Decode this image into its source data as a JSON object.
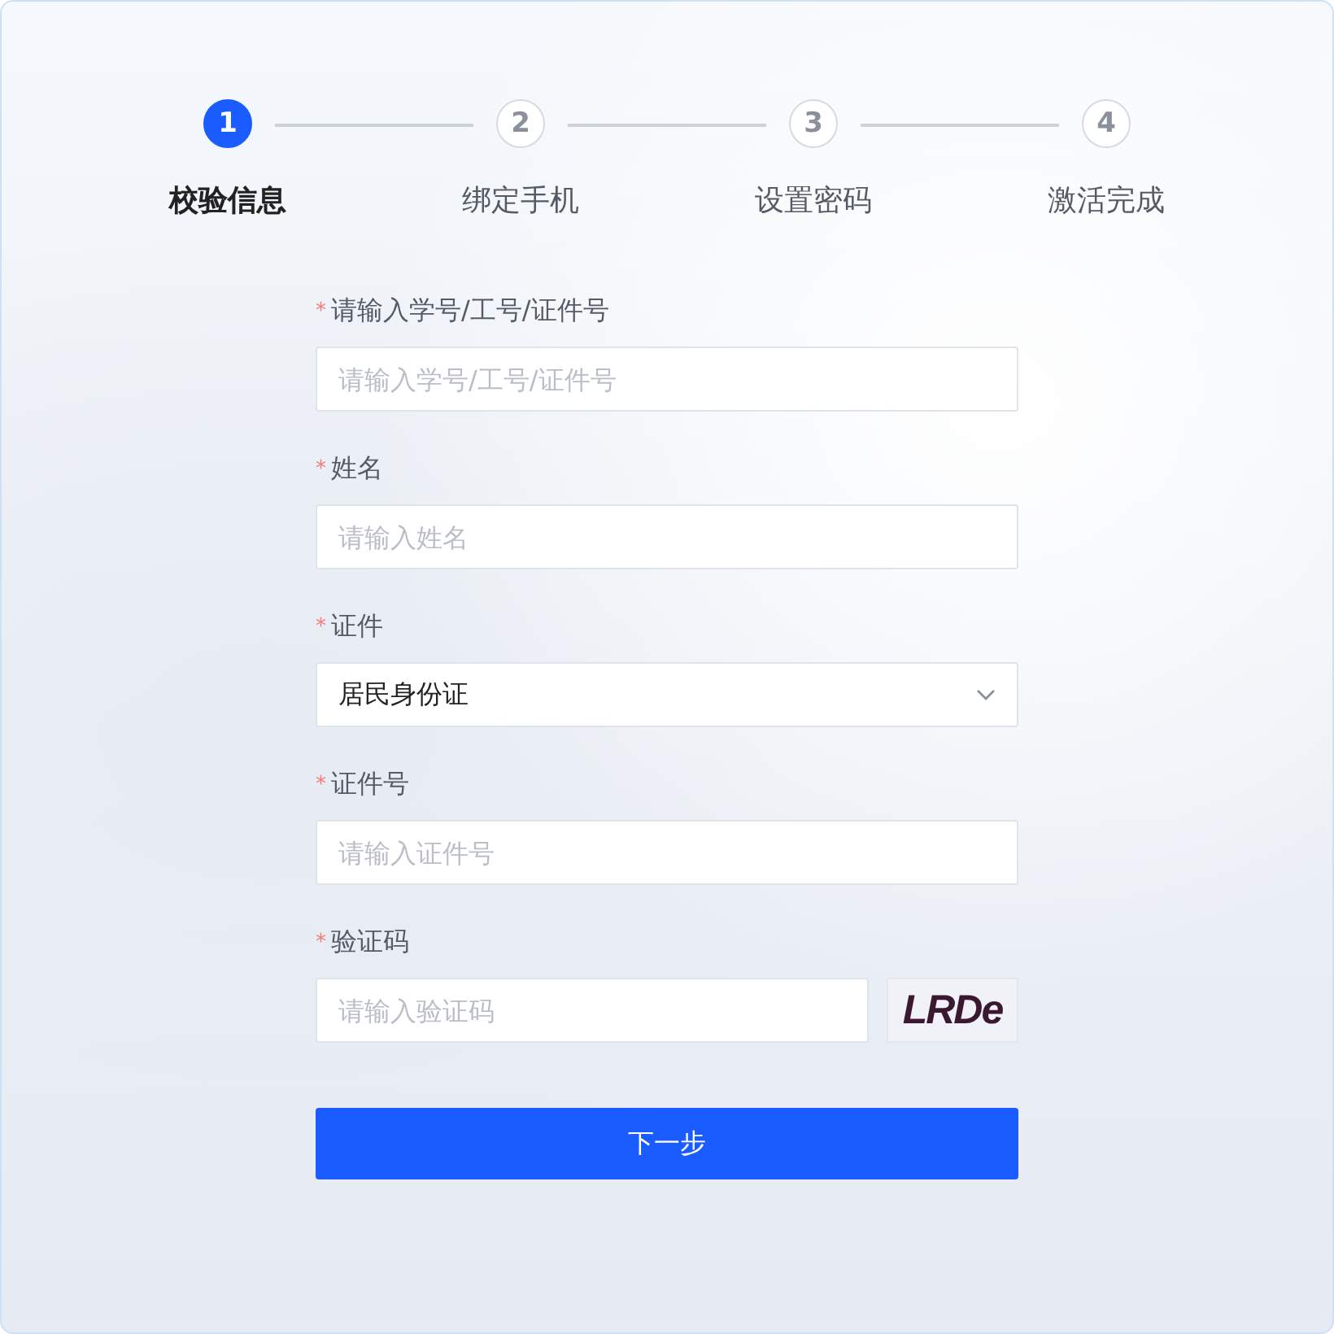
{
  "steps": [
    {
      "number": "1",
      "label": "校验信息",
      "selected": true
    },
    {
      "number": "2",
      "label": "绑定手机",
      "selected": false
    },
    {
      "number": "3",
      "label": "设置密码",
      "selected": false
    },
    {
      "number": "4",
      "label": "激活完成",
      "selected": false
    }
  ],
  "fields": [
    {
      "kind": "text",
      "required_mark": "*",
      "label": "请输入学号/工号/证件号",
      "placeholder": "请输入学号/工号/证件号"
    },
    {
      "kind": "text",
      "required_mark": "*",
      "label": "姓名",
      "placeholder": "请输入姓名"
    },
    {
      "kind": "select",
      "required_mark": "*",
      "label": "证件",
      "value": "居民身份证"
    },
    {
      "kind": "text",
      "required_mark": "*",
      "label": "证件号",
      "placeholder": "请输入证件号"
    },
    {
      "kind": "captcha",
      "required_mark": "*",
      "label": "验证码",
      "placeholder": "请输入验证码",
      "captcha": "LRDe"
    }
  ],
  "submit": "下一步"
}
